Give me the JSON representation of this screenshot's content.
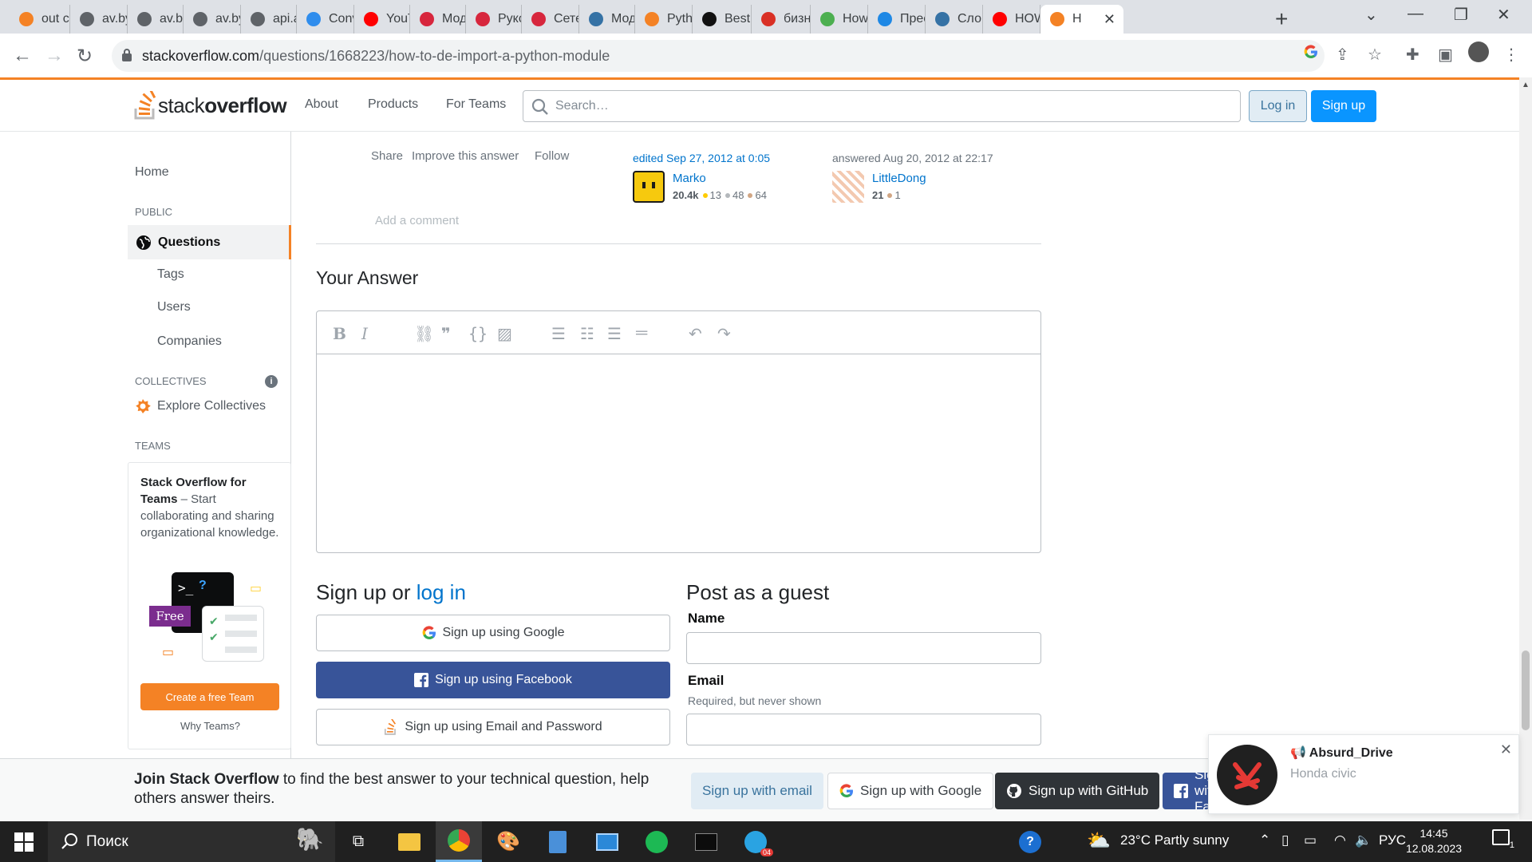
{
  "browser": {
    "tabs": [
      {
        "label": "out c",
        "icon": "stackoverflow-icon",
        "color": "#f48225"
      },
      {
        "label": "av.by",
        "icon": "globe-icon",
        "color": "#5f6368"
      },
      {
        "label": "av.by",
        "icon": "globe-icon",
        "color": "#5f6368"
      },
      {
        "label": "av.by",
        "icon": "globe-icon",
        "color": "#5f6368"
      },
      {
        "label": "api.a",
        "icon": "globe-icon",
        "color": "#5f6368"
      },
      {
        "label": "Conv",
        "icon": "convert-icon",
        "color": "#2f8ded"
      },
      {
        "label": "YouT",
        "icon": "youtube-icon",
        "color": "#ff0000"
      },
      {
        "label": "Мод",
        "icon": "scroll-icon",
        "color": "#d7263d"
      },
      {
        "label": "Руко",
        "icon": "scroll-icon",
        "color": "#d7263d"
      },
      {
        "label": "Сете",
        "icon": "scroll-icon",
        "color": "#d7263d"
      },
      {
        "label": "Мод",
        "icon": "python-icon",
        "color": "#3572a5"
      },
      {
        "label": "Pyth",
        "icon": "stackoverflow-icon",
        "color": "#f48225"
      },
      {
        "label": "Best",
        "icon": "cb-icon",
        "color": "#111111"
      },
      {
        "label": "бизн",
        "icon": "red-circle-icon",
        "color": "#d93025"
      },
      {
        "label": "How",
        "icon": "doc-icon",
        "color": "#4caf50"
      },
      {
        "label": "Прес",
        "icon": "gear-icon",
        "color": "#1e88e5"
      },
      {
        "label": "Слов",
        "icon": "python-icon",
        "color": "#3572a5"
      },
      {
        "label": "HOW",
        "icon": "youtube-icon",
        "color": "#ff0000"
      },
      {
        "label": "H",
        "icon": "stackoverflow-icon",
        "color": "#f48225"
      }
    ],
    "url_host": "stackoverflow.com",
    "url_path": "/questions/1668223/how-to-de-import-a-python-module"
  },
  "header": {
    "logo_text_light": "stack",
    "logo_text_bold": "overflow",
    "nav": [
      "About",
      "Products",
      "For Teams"
    ],
    "search_placeholder": "Search…",
    "login_label": "Log in",
    "signup_label": "Sign up"
  },
  "sidebar": {
    "home": "Home",
    "public_label": "PUBLIC",
    "questions": "Questions",
    "tags": "Tags",
    "users": "Users",
    "companies": "Companies",
    "collectives_label": "COLLECTIVES",
    "explore_collectives": "Explore Collectives",
    "teams_label": "TEAMS",
    "teams_title": "Stack Overflow for Teams",
    "teams_desc": " – Start collaborating and sharing organizational knowledge.",
    "free_badge": "Free",
    "create_team": "Create a free Team",
    "why_teams": "Why Teams?"
  },
  "post": {
    "share": "Share",
    "improve": "Improve this answer",
    "follow": "Follow",
    "edited_text": "edited Sep 27, 2012 at 0:05",
    "editor_name": "Marko",
    "editor_rep": "20.4k",
    "editor_gold": "13",
    "editor_silver": "48",
    "editor_bronze": "64",
    "answered_text": "answered Aug 20, 2012 at 22:17",
    "author_name": "LittleDong",
    "author_rep": "21",
    "author_bronze": "1",
    "add_comment": "Add a comment"
  },
  "answer": {
    "title": "Your Answer",
    "toolbar_icons": [
      "bold-icon",
      "italic-icon",
      "link-icon",
      "quote-icon",
      "code-icon",
      "image-icon",
      "ordered-list-icon",
      "unordered-list-icon",
      "heading-icon",
      "hr-icon",
      "undo-icon",
      "redo-icon"
    ]
  },
  "signup": {
    "title_prefix": "Sign up or ",
    "title_link": "log in",
    "google": "Sign up using Google",
    "facebook": "Sign up using Facebook",
    "email": "Sign up using Email and Password"
  },
  "guest": {
    "title": "Post as a guest",
    "name_label": "Name",
    "email_label": "Email",
    "email_hint": "Required, but never shown"
  },
  "join": {
    "bold": "Join Stack Overflow",
    "text": " to find the best answer to your technical question, help others answer theirs.",
    "email_btn": "Sign up with email",
    "google_btn": "Sign up with Google",
    "github_btn": "Sign up with GitHub",
    "facebook_btn": "Sign up with Facebook"
  },
  "notification": {
    "title": "Absurd_Drive",
    "subtitle": "Honda civic"
  },
  "taskbar": {
    "search_label": "Поиск",
    "weather": "23°C  Partly sunny",
    "lang": "РУС",
    "time": "14:45",
    "date": "12.08.2023",
    "telegram_badge": "04",
    "notif_count": "1"
  },
  "colors": {
    "so_orange": "#f48225",
    "so_blue": "#0a95ff",
    "link_blue": "#0074cc",
    "facebook_blue": "#385499",
    "github_dark": "#2f3337"
  }
}
